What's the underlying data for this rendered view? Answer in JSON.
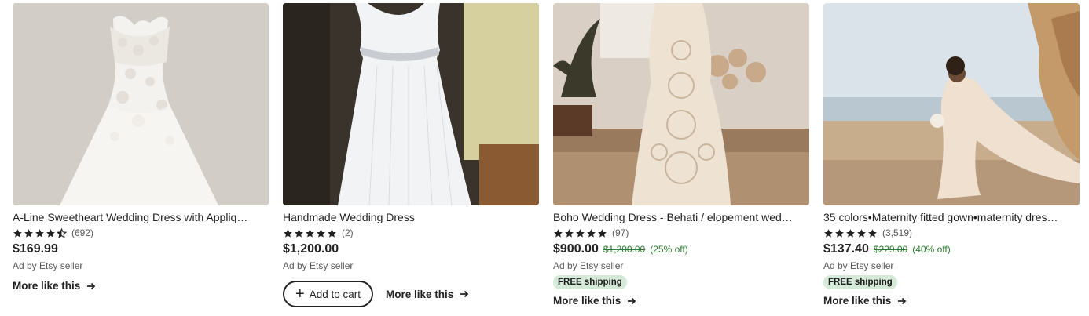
{
  "listings": [
    {
      "title": "A-Line Sweetheart Wedding Dress with Appliq…",
      "rating": 4.5,
      "reviews": "(692)",
      "price": "$169.99",
      "ad_label": "Ad by Etsy seller",
      "more_label": "More like this",
      "image_desc_icon": "wedding-dress-image"
    },
    {
      "title": "Handmade Wedding Dress",
      "rating": 5,
      "reviews": "(2)",
      "price": "$1,200.00",
      "ad_label": "Ad by Etsy seller",
      "cart_label": "Add to cart",
      "more_label": "More like this"
    },
    {
      "title": "Boho Wedding Dress - Behati / elopement wed…",
      "rating": 5,
      "reviews": "(97)",
      "price": "$900.00",
      "original_price": "$1,200.00",
      "discount": "(25% off)",
      "ad_label": "Ad by Etsy seller",
      "badge": "FREE shipping",
      "more_label": "More like this"
    },
    {
      "title": "35 colors•Maternity fitted gown•maternity dres…",
      "rating": 5,
      "reviews": "(3,519)",
      "price": "$137.40",
      "original_price": "$229.00",
      "discount": "(40% off)",
      "ad_label": "Ad by Etsy seller",
      "badge": "FREE shipping",
      "more_label": "More like this"
    }
  ],
  "colors": {
    "sale_green": "#2e7d32",
    "badge_bg": "#d4e9d7",
    "star": "#222222"
  }
}
